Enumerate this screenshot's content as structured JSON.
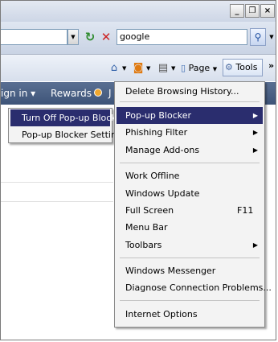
{
  "window": {
    "minimize": "_",
    "maximize": "❐",
    "close": "×"
  },
  "address": {
    "value": ""
  },
  "search": {
    "value": "google"
  },
  "commandbar": {
    "page_label": "Page",
    "tools_label": "Tools"
  },
  "nav": {
    "sign_in": "ign in ▾",
    "rewards": "Rewards",
    "extra": "J"
  },
  "tools_menu": {
    "items": [
      {
        "label": "Delete Browsing History...",
        "shortcut": "",
        "submenu": false
      },
      {
        "label": "Pop-up Blocker",
        "shortcut": "",
        "submenu": true,
        "highlighted": true
      },
      {
        "label": "Phishing Filter",
        "shortcut": "",
        "submenu": true
      },
      {
        "label": "Manage Add-ons",
        "shortcut": "",
        "submenu": true
      },
      {
        "label": "Work Offline",
        "shortcut": "",
        "submenu": false
      },
      {
        "label": "Windows Update",
        "shortcut": "",
        "submenu": false
      },
      {
        "label": "Full Screen",
        "shortcut": "F11",
        "submenu": false
      },
      {
        "label": "Menu Bar",
        "shortcut": "",
        "submenu": false
      },
      {
        "label": "Toolbars",
        "shortcut": "",
        "submenu": true
      },
      {
        "label": "Windows Messenger",
        "shortcut": "",
        "submenu": false
      },
      {
        "label": "Diagnose Connection Problems...",
        "shortcut": "",
        "submenu": false
      },
      {
        "label": "Internet Options",
        "shortcut": "",
        "submenu": false
      }
    ]
  },
  "popup_submenu": {
    "items": [
      {
        "label": "Turn Off Pop-up Blocker",
        "highlighted": true
      },
      {
        "label": "Pop-up Blocker Settings",
        "highlighted": false
      }
    ]
  },
  "icons": [
    "minimize-icon",
    "maximize-icon",
    "close-icon",
    "dropdown-icon",
    "refresh-icon",
    "stop-icon",
    "search-icon",
    "home-icon",
    "rss-feed-icon",
    "print-icon",
    "page-icon",
    "gear-icon",
    "chevron-right-icon",
    "submenu-arrow-icon"
  ]
}
